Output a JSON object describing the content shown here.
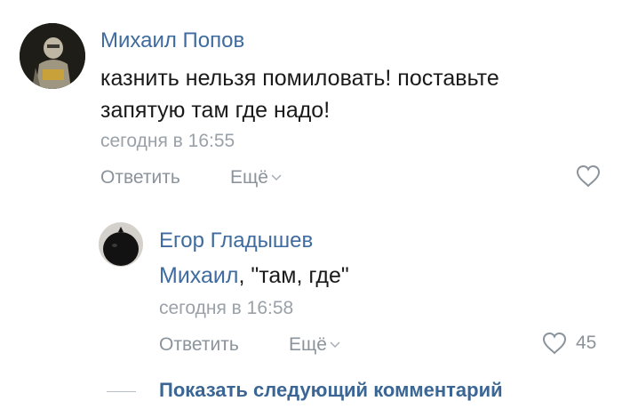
{
  "comment": {
    "author": "Михаил Попов",
    "text_line1": "казнить нельзя помиловать! поставьте",
    "text_line2": "запятую там где надо!",
    "time": "сегодня в 16:55",
    "reply_label": "Ответить",
    "more_label": "Ещё",
    "avatar_icon": "avatar-knight-icon",
    "like_icon": "heart-outline-icon"
  },
  "reply": {
    "author": "Егор Гладышев",
    "mention": "Михаил",
    "text": ", \"там, где\"",
    "time": "сегодня в 16:58",
    "reply_label": "Ответить",
    "more_label": "Ещё",
    "likes": "45",
    "avatar_icon": "avatar-dark-round-icon",
    "like_icon": "heart-outline-icon"
  },
  "next_comment_label": "Показать следующий комментарий",
  "colors": {
    "link": "#3f6b9e",
    "text": "#1a1a1a",
    "muted": "#8b939b"
  }
}
